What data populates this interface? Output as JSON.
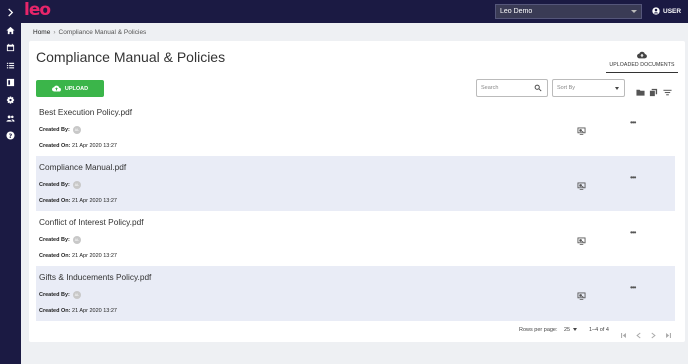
{
  "app": {
    "logo": "leo"
  },
  "sidebar": {
    "items": [
      {
        "icon": "chevron-right-icon"
      },
      {
        "icon": "home-icon"
      },
      {
        "icon": "calendar-icon"
      },
      {
        "icon": "list-icon"
      },
      {
        "icon": "book-icon"
      },
      {
        "icon": "gear-icon"
      },
      {
        "icon": "people-icon"
      },
      {
        "icon": "help-icon"
      }
    ]
  },
  "header": {
    "org_select": "Leo Demo",
    "user_label": "USER"
  },
  "breadcrumb": {
    "home": "Home",
    "separator": "›",
    "current": "Compliance Manual & Policies"
  },
  "page": {
    "title": "Compliance Manual & Policies",
    "tab_label": "UPLOADED DOCUMENTS",
    "upload_label": "UPLOAD",
    "search_placeholder": "Search",
    "sort_placeholder": "Sort By"
  },
  "documents": [
    {
      "name": "Best Execution Policy.pdf",
      "created_by_label": "Created By:",
      "avatar": "AL",
      "created_on_label": "Created On:",
      "created_on": "21 Apr 2020 13:27"
    },
    {
      "name": "Compliance Manual.pdf",
      "created_by_label": "Created By:",
      "avatar": "AL",
      "created_on_label": "Created On:",
      "created_on": "21 Apr 2020 13:27"
    },
    {
      "name": "Conflict of Interest Policy.pdf",
      "created_by_label": "Created By:",
      "avatar": "AL",
      "created_on_label": "Created On:",
      "created_on": "21 Apr 2020 13:27"
    },
    {
      "name": "Gifts & Inducements Policy.pdf",
      "created_by_label": "Created By:",
      "avatar": "AL",
      "created_on_label": "Created On:",
      "created_on": "21 Apr 2020 13:27"
    }
  ],
  "pagination": {
    "rows_label": "Rows per page:",
    "rows_value": "25",
    "range": "1–4 of 4"
  },
  "colors": {
    "nav": "#1b1a43",
    "brand": "#e7256a",
    "upload": "#3bb54a",
    "row_alt": "#e9ecf6"
  }
}
